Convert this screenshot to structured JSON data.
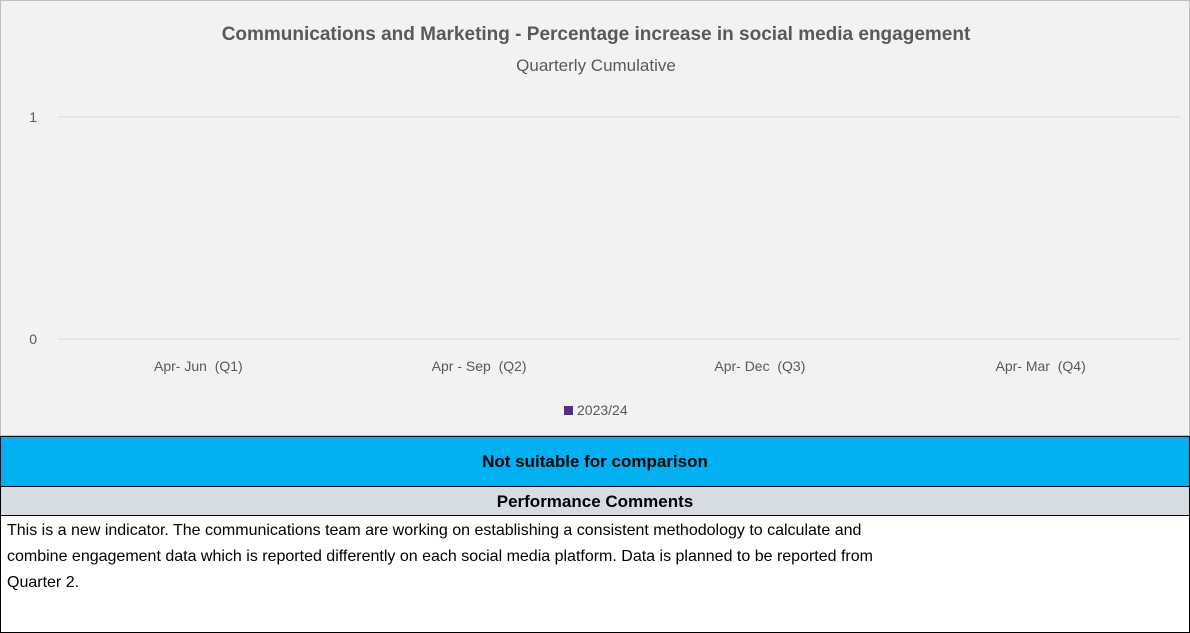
{
  "chart_data": {
    "type": "bar",
    "title": "Communications and Marketing - Percentage increase in social media engagement",
    "subtitle": "Quarterly Cumulative",
    "categories": [
      "Apr- Jun  (Q1)",
      "Apr - Sep  (Q2)",
      "Apr- Dec  (Q3)",
      "Apr- Mar  (Q4)"
    ],
    "series": [
      {
        "name": "2023/24",
        "values": [
          null,
          null,
          null,
          null
        ],
        "color": "#5b2c83"
      }
    ],
    "ylim": [
      0,
      1
    ],
    "yticks": [
      "0",
      "1"
    ],
    "grid": true,
    "legend_position": "bottom"
  },
  "comparison_band": {
    "text": "Not suitable for comparison",
    "color": "#00b0f0"
  },
  "comments": {
    "header": "Performance Comments",
    "header_color": "#d6dce4",
    "lines": [
      "This is a new indicator. The communications team are working on establishing a consistent methodology to calculate and",
      "combine engagement data which is reported differently on each social media platform. Data is planned to be reported from",
      "Quarter 2."
    ]
  }
}
